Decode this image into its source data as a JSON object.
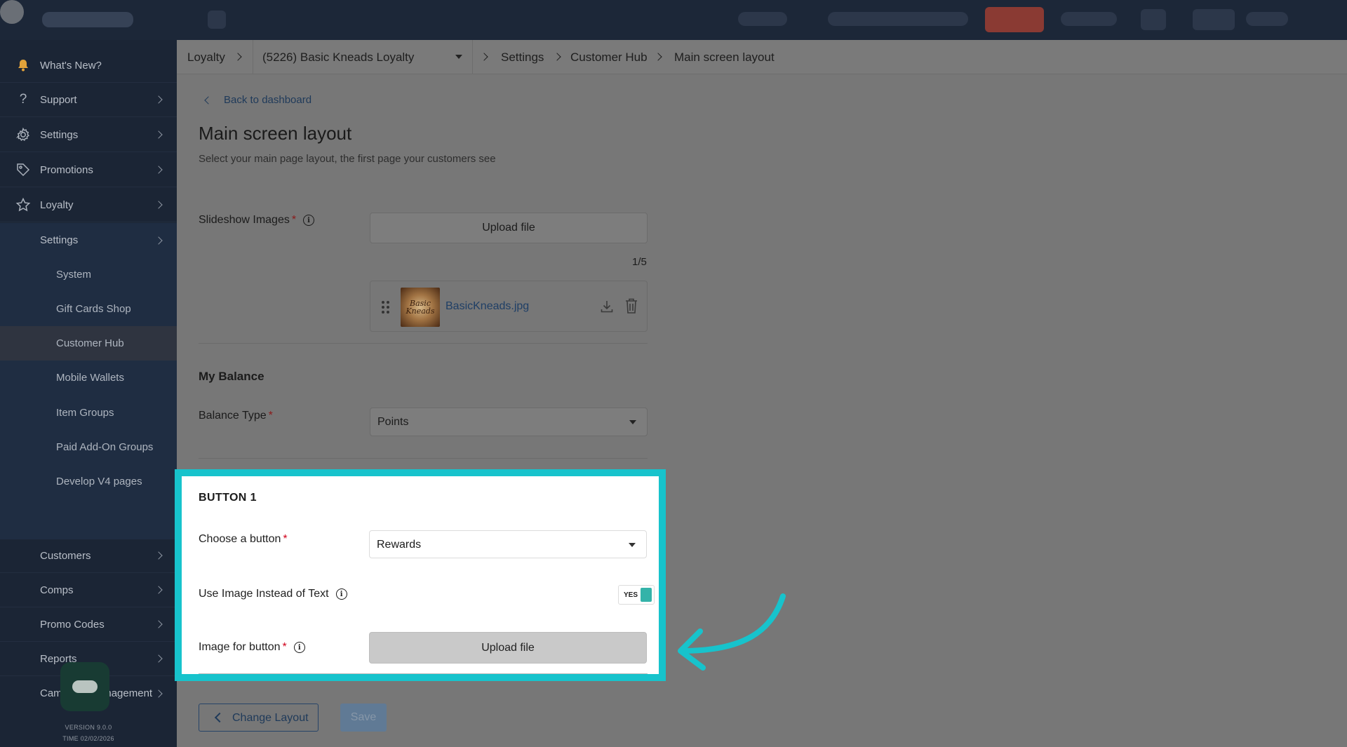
{
  "sidebar": {
    "top_items": [
      {
        "label": "What's New?",
        "icon": "bell-icon"
      },
      {
        "label": "Support",
        "icon": "question-icon"
      },
      {
        "label": "Settings",
        "icon": "gear-icon"
      },
      {
        "label": "Promotions",
        "icon": "tag-icon"
      },
      {
        "label": "Loyalty",
        "icon": "star-icon"
      }
    ],
    "loyalty_settings": "Settings",
    "sub_items": [
      "System",
      "Gift Cards Shop",
      "Customer Hub",
      "Mobile Wallets",
      "Item Groups",
      "Paid Add-On Groups",
      "Develop V4 pages"
    ],
    "active_sub": "Customer Hub",
    "bottom_items": [
      "Customers",
      "Comps",
      "Promo Codes",
      "Reports",
      "Campaign Management"
    ],
    "version": "VERSION 9.0.0",
    "time": "TIME 02/02/2026"
  },
  "breadcrumb": {
    "root": "Loyalty",
    "program": "(5226) Basic Kneads Loyalty",
    "items": [
      "Settings",
      "Customer Hub",
      "Main screen layout"
    ]
  },
  "page": {
    "back_link": "Back to dashboard",
    "title": "Main screen layout",
    "subtitle": "Select your main page layout, the first page your customers see"
  },
  "slideshow": {
    "label": "Slideshow Images",
    "upload_label": "Upload file",
    "counter": "1/5",
    "file_name": "BasicKneads.jpg",
    "thumb_text": "Basic Kneads"
  },
  "balance": {
    "section_title": "My Balance",
    "type_label": "Balance Type",
    "type_value": "Points"
  },
  "button1": {
    "title": "BUTTON 1",
    "choose_label": "Choose a button",
    "choose_value": "Rewards",
    "use_image_label": "Use Image Instead of Text",
    "toggle_label": "YES",
    "image_label": "Image for button",
    "upload_label": "Upload file"
  },
  "footer": {
    "change_layout": "Change Layout",
    "save": "Save"
  },
  "colors": {
    "highlight": "#17c3cc",
    "toggle_on": "#34b3a9",
    "sidebar_bg": "#1b2535"
  }
}
